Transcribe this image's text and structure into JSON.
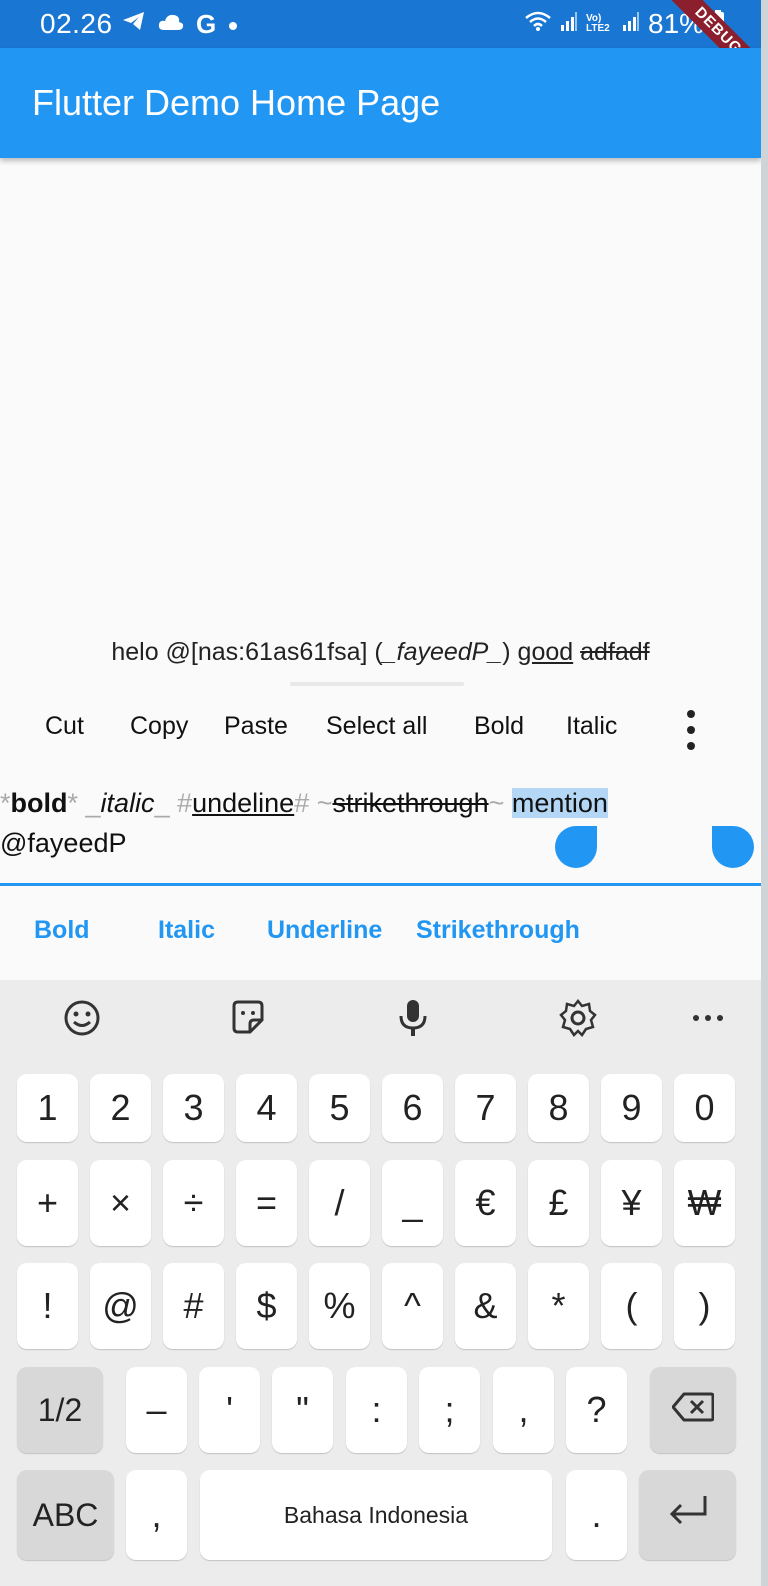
{
  "status_bar": {
    "time": "02.26",
    "left_icons": [
      "telegram-icon",
      "cloud-icon",
      "google-icon",
      "dot-icon"
    ],
    "right_icons": [
      "wifi-icon",
      "signal-icon",
      "volte-icon",
      "signal-icon"
    ],
    "network_label": "Vo) LTE2",
    "battery": "81%",
    "debug_banner": "DEBUG",
    "colors": {
      "bar": "#1976d2"
    }
  },
  "app_bar": {
    "title": "Flutter Demo Home Page",
    "color": "#2196f3"
  },
  "preview": {
    "segments": [
      {
        "text": "helo @[nas:61as61fsa] (",
        "style": "plain"
      },
      {
        "text": "_fayeedP_",
        "style": "italic"
      },
      {
        "text": ") ",
        "style": "plain"
      },
      {
        "text": "good",
        "style": "underline"
      },
      {
        "text": " ",
        "style": "plain"
      },
      {
        "text": "adfadf",
        "style": "strike"
      }
    ]
  },
  "selection_toolbar": {
    "items": [
      "Cut",
      "Copy",
      "Paste",
      "Select all",
      "Bold",
      "Italic"
    ],
    "more_icon": "more-vert-icon"
  },
  "text_field": {
    "line1": [
      {
        "text": "*",
        "style": "marker"
      },
      {
        "text": "bold",
        "style": "bold"
      },
      {
        "text": "* ",
        "style": "marker"
      },
      {
        "text": "_",
        "style": "marker"
      },
      {
        "text": "italic",
        "style": "italic"
      },
      {
        "text": "_ #",
        "style": "marker"
      },
      {
        "text": "undeline",
        "style": "underline"
      },
      {
        "text": "# ~",
        "style": "marker"
      },
      {
        "text": "strikethrough",
        "style": "strike"
      },
      {
        "text": "~ ",
        "style": "marker"
      },
      {
        "text": "mention",
        "style": "selected"
      }
    ],
    "line2": "@fayeedP",
    "selection_color": "#b3d7f5",
    "accent": "#2196f3"
  },
  "format_buttons": [
    "Bold",
    "Italic",
    "Underline",
    "Strikethrough"
  ],
  "keyboard": {
    "toolbar_icons": [
      "emoji-icon",
      "sticker-icon",
      "microphone-icon",
      "settings-icon",
      "more-horiz-icon"
    ],
    "row1": [
      "1",
      "2",
      "3",
      "4",
      "5",
      "6",
      "7",
      "8",
      "9",
      "0"
    ],
    "row2": [
      "+",
      "×",
      "÷",
      "=",
      "/",
      "_",
      "€",
      "£",
      "¥",
      "₩"
    ],
    "row3": [
      "!",
      "@",
      "#",
      "$",
      "%",
      "^",
      "&",
      "*",
      "(",
      ")"
    ],
    "row4_page": "1/2",
    "row4": [
      "–",
      "'",
      "\"",
      ":",
      ";",
      ",",
      "?"
    ],
    "row5": {
      "abc": "ABC",
      "comma": ",",
      "space": "Bahasa Indonesia",
      "period": "."
    },
    "backspace_icon": "backspace-icon",
    "enter_icon": "enter-icon"
  }
}
